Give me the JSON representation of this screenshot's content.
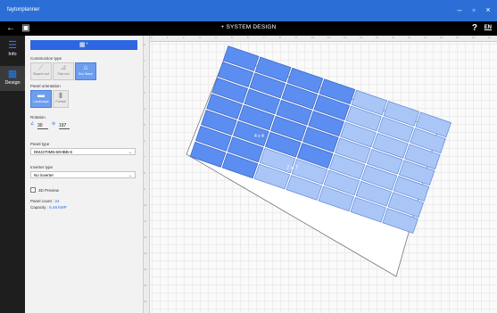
{
  "app": {
    "title": "faytonplanner"
  },
  "toolbar": {
    "title": "SYSTEM DESIGN",
    "help": "?",
    "lang": "EN"
  },
  "rail": {
    "items": [
      {
        "label": "Info",
        "icon": "list-icon"
      },
      {
        "label": "Design",
        "icon": "grid-icon"
      }
    ]
  },
  "panel": {
    "add_button_icon": "add-panel-icon",
    "construction_label": "Construction type",
    "construction_options": [
      "Sloped roof",
      "Flat roof",
      "Sun Wave"
    ],
    "orientation_label": "Panel orientation",
    "orientation_options": [
      "Landscape",
      "Portrait"
    ],
    "rotation_label": "Rotation",
    "tilt_value": "30",
    "azimuth_value": "197",
    "panel_type_label": "Panel type",
    "panel_type_value": "DMJ270M6-60HBB-S",
    "inverter_label": "Inverter type",
    "inverter_value": "No inverter",
    "preview_label": "3D Preview",
    "panel_count_label": "Panel count",
    "panel_count_value": ": 24",
    "capacity_label": "Capacity",
    "capacity_value": ": 6.48 kWP"
  },
  "canvas": {
    "array_a_label": "4 x 4",
    "array_b_label": "7 x 7"
  },
  "colors": {
    "accent": "#2d66e0",
    "titlebar": "#2b6fd6",
    "panel_dark": "#5b8ef0",
    "panel_light": "#a9c6f7"
  }
}
